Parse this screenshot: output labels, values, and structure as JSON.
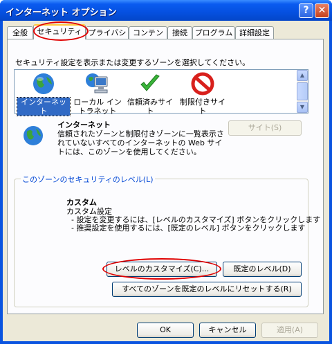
{
  "window": {
    "title": "インターネット オプション",
    "help_label": "?",
    "close_label": "✕"
  },
  "tabs": [
    "全般",
    "セキュリティ",
    "プライバシー",
    "コンテンツ",
    "接続",
    "プログラム",
    "詳細設定"
  ],
  "security": {
    "instruction": "セキュリティ設定を表示または変更するゾーンを選択してください。",
    "zones": [
      {
        "label": "インターネット",
        "icon": "globe-icon"
      },
      {
        "label": "ローカル イントラネット",
        "icon": "computer-globe-icon"
      },
      {
        "label": "信頼済みサイト",
        "icon": "checkmark-icon"
      },
      {
        "label": "制限付きサイト",
        "icon": "prohibited-icon"
      }
    ],
    "zone_title": "インターネット",
    "zone_desc": "信頼されたゾーンと制限付きゾーンに一覧表示されていないすべてのインターネットの Web サイトには、このゾーンを使用してください。",
    "sites_button": "サイト(S)",
    "group_label": "このゾーンのセキュリティのレベル(L)",
    "level_title": "カスタム",
    "level_desc": "カスタム設定\n  - 設定を変更するには、[レベルのカスタマイズ] ボタンをクリックします\n  - 推奨設定を使用するには、[既定のレベル] ボタンをクリックします",
    "customize_button": "レベルのカスタマイズ(C)...",
    "default_button": "既定のレベル(D)",
    "reset_button": "すべてのゾーンを既定のレベルにリセットする(R)"
  },
  "footer": {
    "ok": "OK",
    "cancel": "キャンセル",
    "apply": "適用(A)"
  },
  "colors": {
    "titlebar": "#0A5BF0",
    "dialog_bg": "#ECE9D8",
    "selection": "#316AC5",
    "highlight_ring": "#E00000"
  }
}
